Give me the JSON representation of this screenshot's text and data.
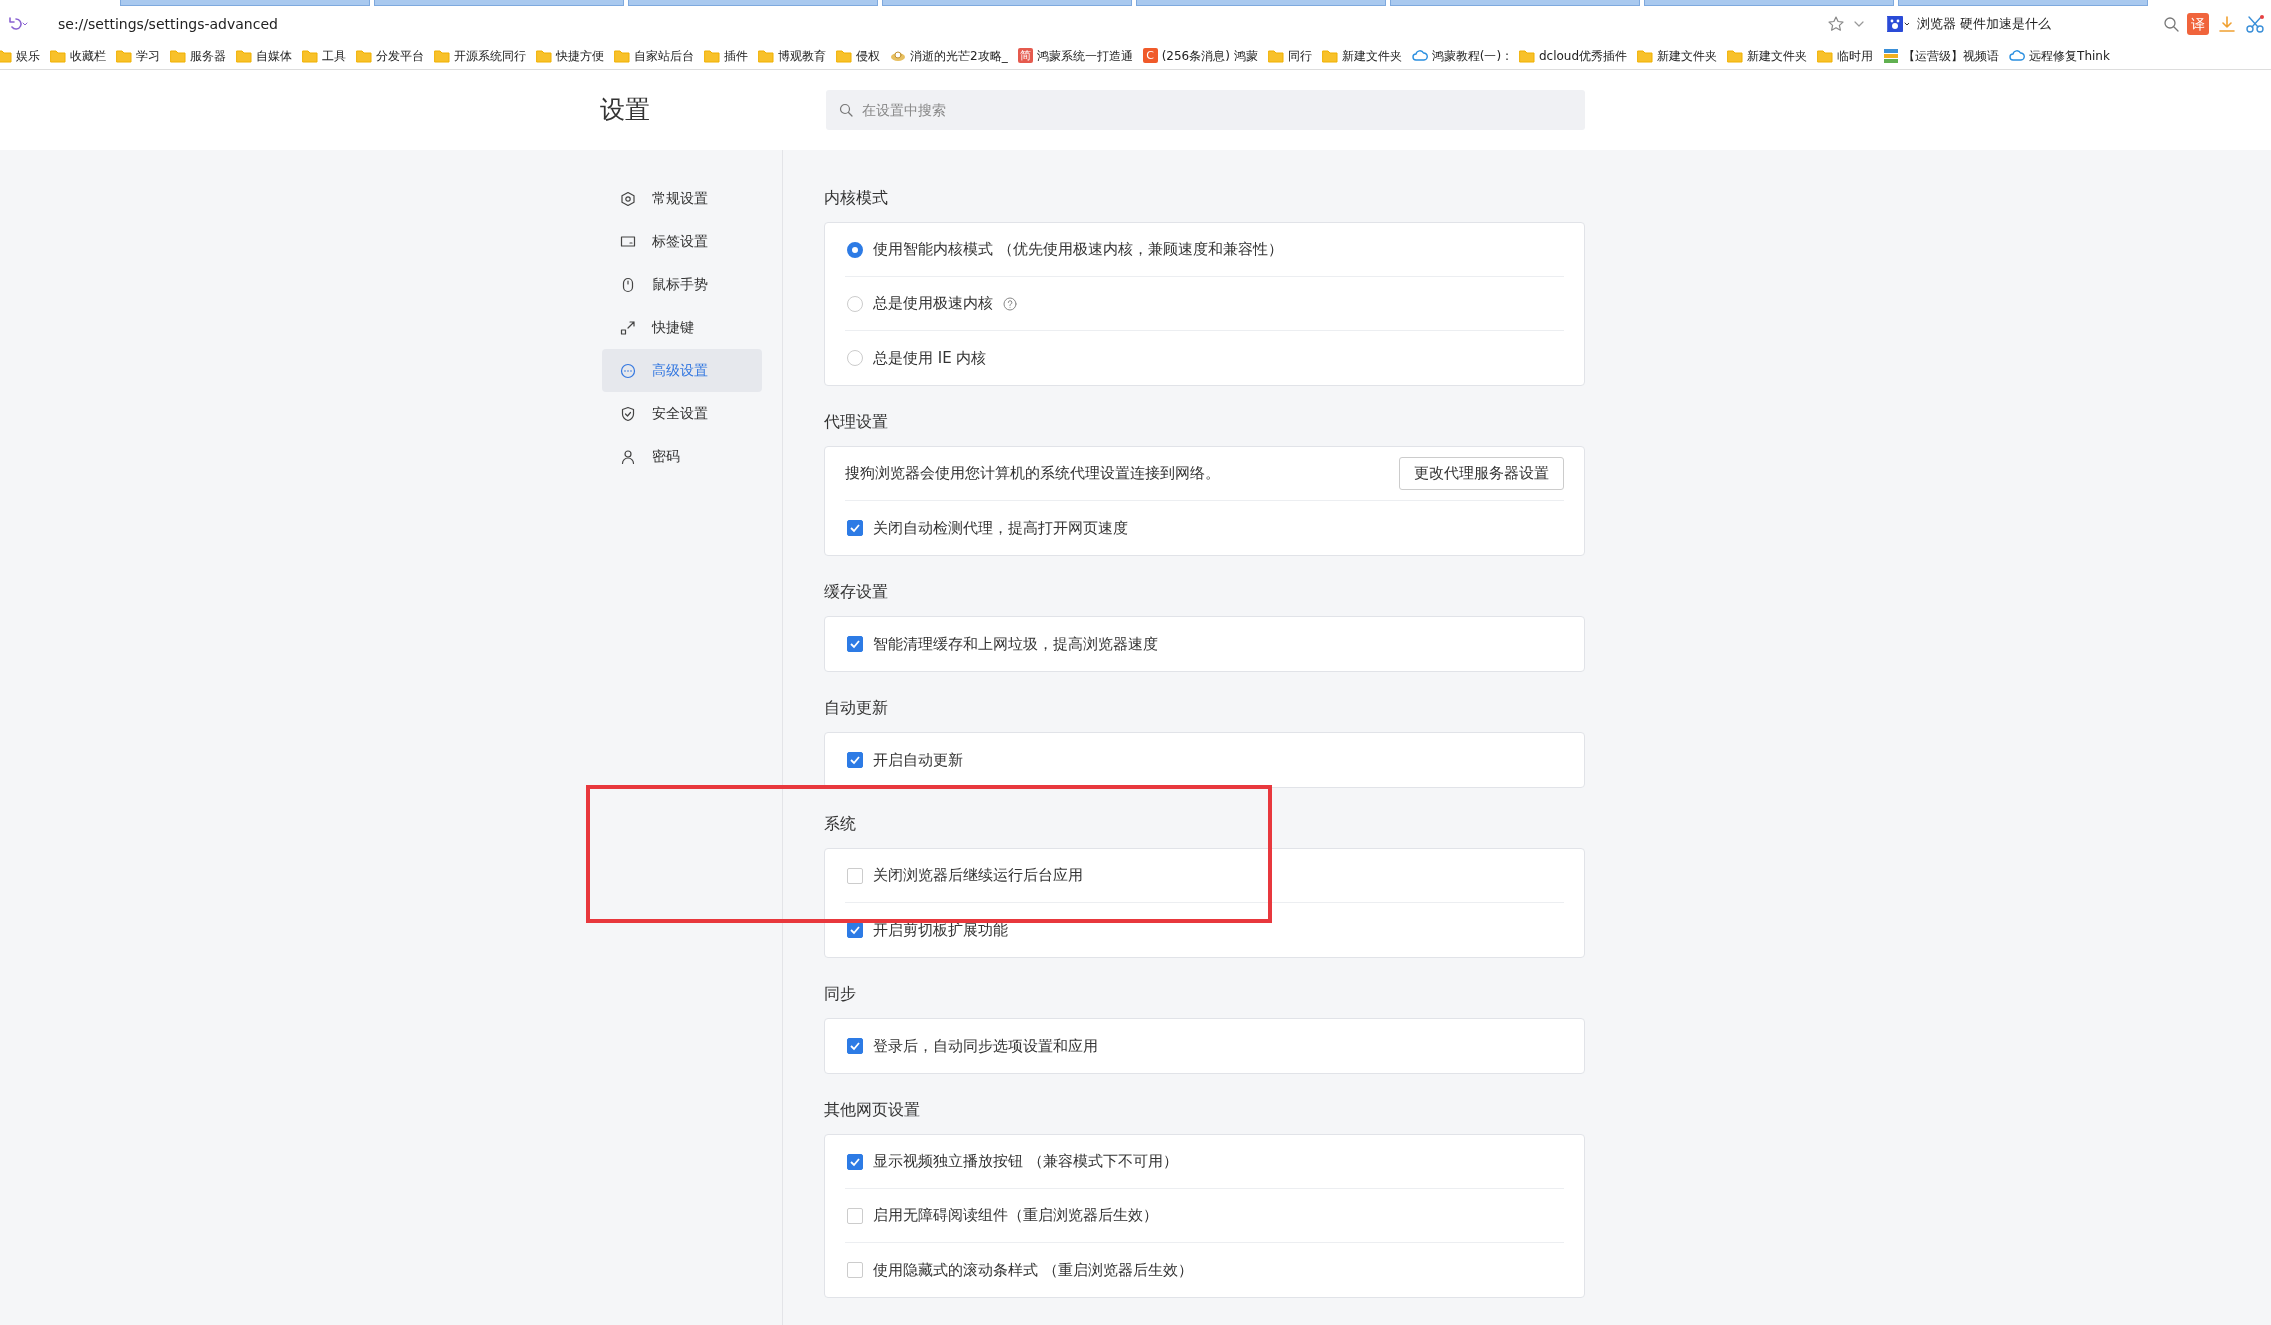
{
  "browser": {
    "address": "se://settings/settings-advanced",
    "search_text": "浏览器 硬件加速是什么",
    "translate_label": "译",
    "bookmarks": [
      {
        "kind": "folder",
        "label": "娱乐"
      },
      {
        "kind": "folder",
        "label": "收藏栏"
      },
      {
        "kind": "folder",
        "label": "学习"
      },
      {
        "kind": "folder",
        "label": "服务器"
      },
      {
        "kind": "folder",
        "label": "自媒体"
      },
      {
        "kind": "folder",
        "label": "工具"
      },
      {
        "kind": "folder",
        "label": "分发平台"
      },
      {
        "kind": "folder",
        "label": "开源系统同行"
      },
      {
        "kind": "folder",
        "label": "快捷方便"
      },
      {
        "kind": "folder",
        "label": "自家站后台"
      },
      {
        "kind": "folder",
        "label": "插件"
      },
      {
        "kind": "folder",
        "label": "博观教育"
      },
      {
        "kind": "folder",
        "label": "侵权"
      },
      {
        "kind": "game",
        "label": "消逝的光芒2攻略_"
      },
      {
        "kind": "letter",
        "icon_text": "简",
        "color": "#e55a4e",
        "label": "鸿蒙系统一打造通"
      },
      {
        "kind": "letter",
        "icon_text": "C",
        "color": "#f05a2a",
        "label": "(256条消息) 鸿蒙"
      },
      {
        "kind": "folder",
        "label": "同行"
      },
      {
        "kind": "folder",
        "label": "新建文件夹"
      },
      {
        "kind": "cloud",
        "label": "鸿蒙教程(一) :"
      },
      {
        "kind": "folder",
        "label": "dcloud优秀插件"
      },
      {
        "kind": "folder",
        "label": "新建文件夹"
      },
      {
        "kind": "folder",
        "label": "新建文件夹"
      },
      {
        "kind": "folder",
        "label": "临时用"
      },
      {
        "kind": "app",
        "label": "【运营级】视频语"
      },
      {
        "kind": "cloud",
        "label": "远程修复Think"
      }
    ]
  },
  "page": {
    "title": "设置",
    "search": {
      "placeholder": "在设置中搜索"
    },
    "sidebar": {
      "items": [
        {
          "kind": "general",
          "label": "常规设置",
          "selected": false
        },
        {
          "kind": "tabs",
          "label": "标签设置",
          "selected": false
        },
        {
          "kind": "mouse",
          "label": "鼠标手势",
          "selected": false
        },
        {
          "kind": "shortcut",
          "label": "快捷键",
          "selected": false
        },
        {
          "kind": "advanced",
          "label": "高级设置",
          "selected": true
        },
        {
          "kind": "security",
          "label": "安全设置",
          "selected": false
        },
        {
          "kind": "password",
          "label": "密码",
          "selected": false
        }
      ]
    },
    "sections": [
      {
        "title": "内核模式",
        "rows": [
          {
            "kind": "radio",
            "label": "使用智能内核模式 （优先使用极速内核，兼顾速度和兼容性）",
            "checked": true
          },
          {
            "kind": "radio",
            "label": "总是使用极速内核",
            "checked": false,
            "help": true
          },
          {
            "kind": "radio",
            "label": "总是使用 IE 内核",
            "checked": false
          }
        ]
      },
      {
        "title": "代理设置",
        "rows": [
          {
            "kind": "text",
            "label": "搜狗浏览器会使用您计算机的系统代理设置连接到网络。",
            "button": "更改代理服务器设置"
          },
          {
            "kind": "checkbox",
            "label": "关闭自动检测代理，提高打开网页速度",
            "checked": true
          }
        ]
      },
      {
        "title": "缓存设置",
        "rows": [
          {
            "kind": "checkbox",
            "label": "智能清理缓存和上网垃圾，提高浏览器速度",
            "checked": true
          }
        ]
      },
      {
        "title": "自动更新",
        "rows": [
          {
            "kind": "checkbox",
            "label": "开启自动更新",
            "checked": true
          }
        ]
      },
      {
        "title": "系统",
        "rows": [
          {
            "kind": "checkbox",
            "label": "关闭浏览器后继续运行后台应用",
            "checked": false
          },
          {
            "kind": "checkbox",
            "label": "开启剪切板扩展功能",
            "checked": true
          }
        ]
      },
      {
        "title": "同步",
        "rows": [
          {
            "kind": "checkbox",
            "label": "登录后，自动同步选项设置和应用",
            "checked": true
          }
        ]
      },
      {
        "title": "其他网页设置",
        "rows": [
          {
            "kind": "checkbox",
            "label": "显示视频独立播放按钮 （兼容模式下不可用）",
            "checked": true
          },
          {
            "kind": "checkbox",
            "label": "启用无障碍阅读组件（重启浏览器后生效）",
            "checked": false
          },
          {
            "kind": "checkbox",
            "label": "使用隐藏式的滚动条样式 （重启浏览器后生效）",
            "checked": false
          }
        ]
      }
    ],
    "annotation": {
      "kind": "frame"
    }
  }
}
